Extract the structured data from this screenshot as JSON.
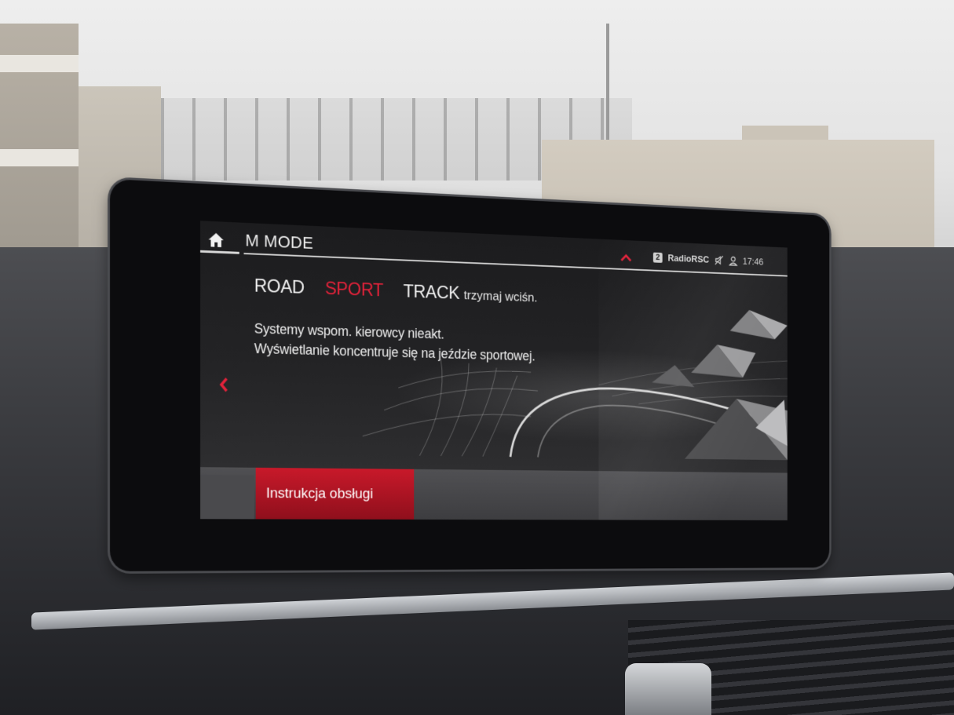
{
  "header": {
    "title": "M MODE",
    "source_badge": "2",
    "source_name": "RadioRSC",
    "time": "17:46"
  },
  "modes": {
    "road": "ROAD",
    "sport": "SPORT",
    "track": "TRACK",
    "track_hint": "trzymaj wciśn.",
    "active": "SPORT"
  },
  "description": {
    "line1": "Systemy wspom. kierowcy nieakt.",
    "line2": "Wyświetlanie koncentruje się na jeździe sportowej."
  },
  "bottom": {
    "manual_label": "Instrukcja obsługi"
  },
  "icons": {
    "home": "home-icon",
    "up": "chevron-up-icon",
    "mute": "speaker-muted-icon",
    "profile": "user-icon",
    "back": "chevron-left-icon"
  },
  "colors": {
    "accent": "#e2223a",
    "screen_bg": "#151517",
    "button_red": "#c8192a"
  }
}
